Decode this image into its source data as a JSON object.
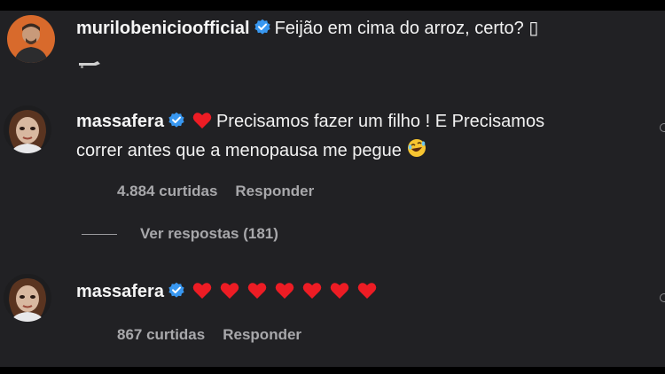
{
  "comments": [
    {
      "username": "murilobenicioofficial",
      "text": "Feijão em cima do arroz, certo? ▯",
      "likes": "",
      "reply": ""
    },
    {
      "username": "massafera",
      "text_line1": "Precisamos fazer um filho ! E Precisamos",
      "text_line2": "correr antes que a menopausa me pegue",
      "likes": "4.884 curtidas",
      "reply": "Responder",
      "view_replies": "Ver respostas (181)"
    },
    {
      "username": "massafera",
      "hearts": 7,
      "likes": "867 curtidas",
      "reply": "Responder"
    }
  ],
  "colors": {
    "background": "#212124",
    "verified": "#3897f0",
    "heart": "#ed1c24",
    "meta": "#a8a8ab"
  },
  "icons": [
    "verified-badge-icon",
    "heart-icon",
    "laughing-emoji-icon"
  ]
}
